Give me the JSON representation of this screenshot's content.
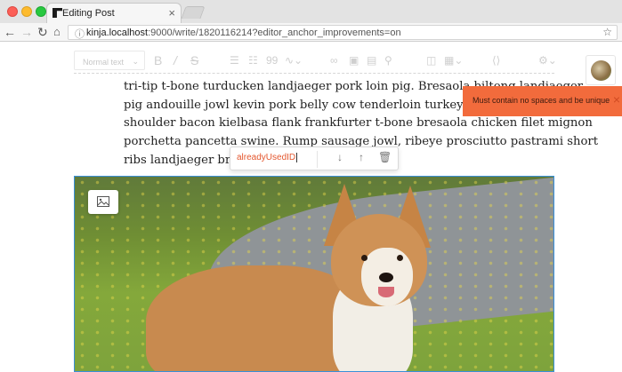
{
  "browser": {
    "tab_title": "Editing Post",
    "tab_close": "×",
    "url_host": "kinja.localhost",
    "url_rest": ":9000/write/1820116214?editor_anchor_improvements=on"
  },
  "toolbar": {
    "paragraph_style": "Normal text",
    "icons": [
      "bold-icon",
      "italic-icon",
      "strikethrough-icon",
      "bulleted-list-icon",
      "numbered-list-icon",
      "quote-icon",
      "divider-icon",
      "link-icon",
      "image-icon",
      "video-icon",
      "embed-icon",
      "layout-icon",
      "table-icon",
      "code-icon",
      "settings-icon"
    ]
  },
  "toast": {
    "message": "Must contain no spaces and be unique",
    "close_label": "×"
  },
  "article": {
    "lines": [
      "tri-tip t-bone turducken landjaeger pork loin pig. Bresaola biltong landjaeger",
      "pig andouille jowl kevin pork belly cow tenderloin turkey pork. Jerky andouille",
      "shoulder bacon kielbasa flank frankfurter t-bone bresaola chicken filet mignon",
      "porchetta pancetta swine. Rump sausage jowl, ribeye prosciutto pastrami short",
      "ribs landjaeger bresaola"
    ]
  },
  "anchor_popover": {
    "value": "alreadyUsedID"
  },
  "colors": {
    "accent_orange": "#f26b3c",
    "selection_blue": "#3a90d8",
    "error_text": "#e4572e"
  }
}
